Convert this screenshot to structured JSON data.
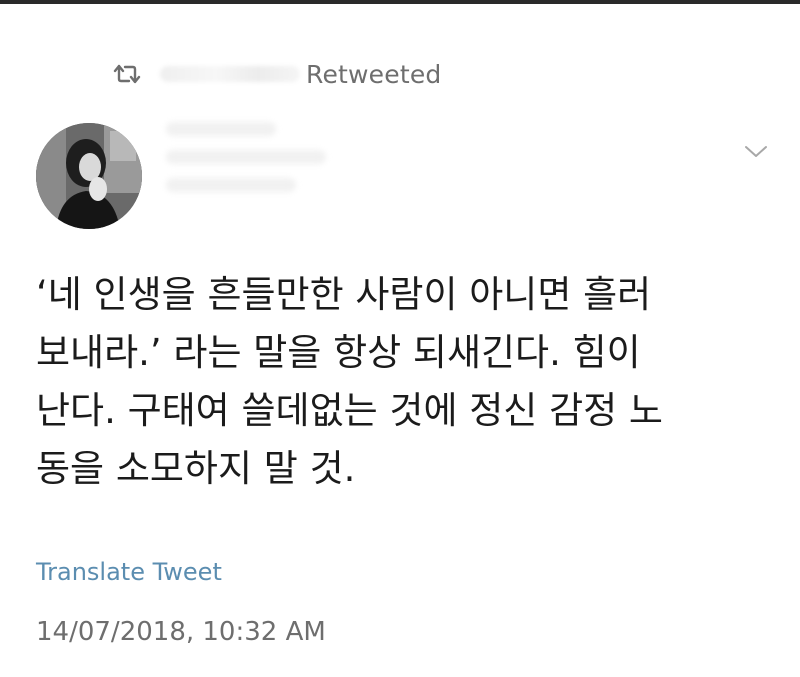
{
  "retweet": {
    "icon": "retweet-icon",
    "label": "Retweeted"
  },
  "author": {
    "avatar": "avatar"
  },
  "tweet": {
    "lines": [
      "‘네 인생을 흔들만한 사람이 아니면 흘러",
      "보내라.’ 라는 말을 항상 되새긴다. 힘이",
      "난다. 구태여 쓸데없는 것에 정신 감정 노",
      "동을 소모하지 말 것."
    ],
    "more_icon": "chevron-down-icon"
  },
  "translate_link": "Translate Tweet",
  "timestamp": "14/07/2018, 10:32 AM",
  "colors": {
    "link": "#5b8db0",
    "muted": "#6e6e6e",
    "text": "#1b1b1b"
  }
}
